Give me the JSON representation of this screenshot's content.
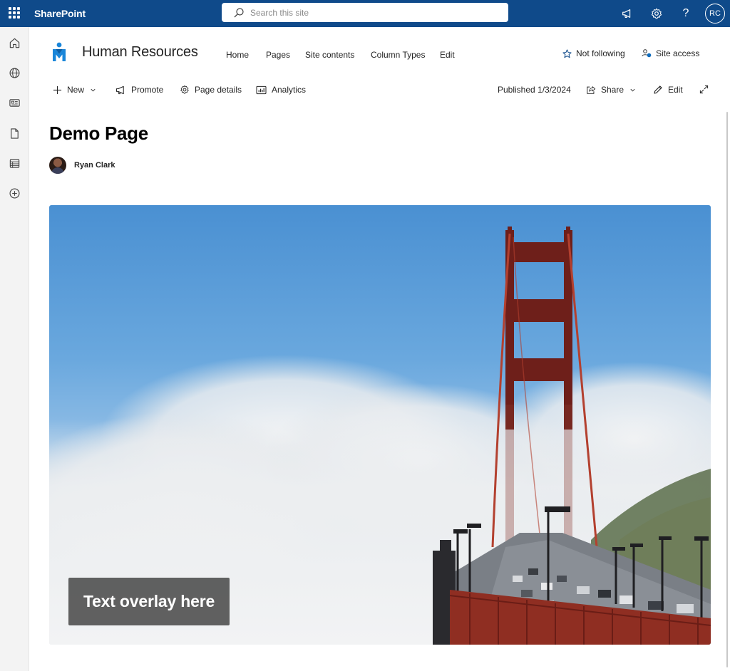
{
  "suitebar": {
    "app_name": "SharePoint",
    "search_placeholder": "Search this site",
    "user_initials": "RC",
    "background": "#0f4a8a"
  },
  "site": {
    "title": "Human Resources",
    "nav": [
      "Home",
      "Pages",
      "Site contents",
      "Column Types",
      "Edit"
    ],
    "follow_label": "Not following",
    "access_label": "Site access"
  },
  "commandbar": {
    "new_label": "New",
    "promote_label": "Promote",
    "page_details_label": "Page details",
    "analytics_label": "Analytics",
    "published_label": "Published 1/3/2024",
    "share_label": "Share",
    "edit_label": "Edit"
  },
  "page": {
    "title": "Demo Page",
    "author": "Ryan Clark"
  },
  "hero": {
    "overlay_text": "Text overlay here"
  }
}
